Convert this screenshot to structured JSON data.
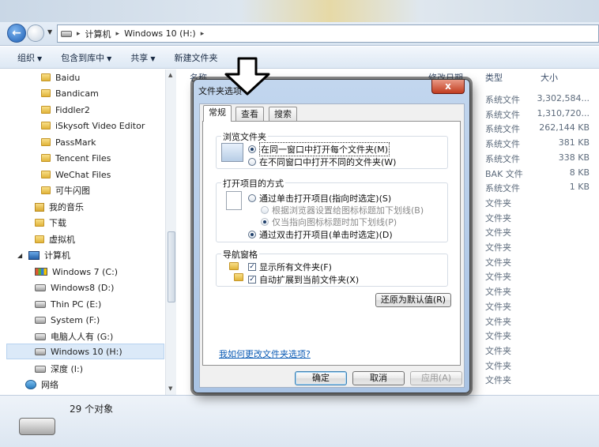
{
  "address": {
    "path": [
      "计算机",
      "Windows 10 (H:)"
    ]
  },
  "toolbar": {
    "items": [
      "组织",
      "包含到库中",
      "共享",
      "新建文件夹"
    ]
  },
  "nav": {
    "items": [
      {
        "label": "Baidu",
        "kind": "folder"
      },
      {
        "label": "Bandicam",
        "kind": "folder"
      },
      {
        "label": "Fiddler2",
        "kind": "folder"
      },
      {
        "label": "iSkysoft Video Editor",
        "kind": "folder"
      },
      {
        "label": "PassMark",
        "kind": "folder"
      },
      {
        "label": "Tencent Files",
        "kind": "folder"
      },
      {
        "label": "WeChat Files",
        "kind": "folder"
      },
      {
        "label": "可牛闪图",
        "kind": "folder"
      },
      {
        "label": "我的音乐",
        "kind": "music"
      },
      {
        "label": "下载",
        "kind": "download"
      },
      {
        "label": "虚拟机",
        "kind": "folder"
      },
      {
        "label": "计算机",
        "kind": "pc"
      },
      {
        "label": "Windows 7  (C:)",
        "kind": "win"
      },
      {
        "label": "Windows8 (D:)",
        "kind": "drive"
      },
      {
        "label": "Thin PC (E:)",
        "kind": "drive"
      },
      {
        "label": "System (F:)",
        "kind": "drive"
      },
      {
        "label": "电脑人人有 (G:)",
        "kind": "drive"
      },
      {
        "label": "Windows 10 (H:)",
        "kind": "drive",
        "selected": true
      },
      {
        "label": "深度 (I:)",
        "kind": "drive"
      },
      {
        "label": "网络",
        "kind": "net"
      }
    ]
  },
  "filelist": {
    "header_name": "名称",
    "header_date": "修改日期",
    "header_type": "类型",
    "header_size": "大小",
    "rows": [
      {
        "type": "系统文件",
        "size": "3,302,584..."
      },
      {
        "type": "系统文件",
        "size": "1,310,720..."
      },
      {
        "type": "系统文件",
        "size": "262,144 KB"
      },
      {
        "type": "系统文件",
        "size": "381 KB"
      },
      {
        "type": "系统文件",
        "size": "338 KB"
      },
      {
        "type": "BAK 文件",
        "size": "8 KB"
      },
      {
        "type": "系统文件",
        "size": "1 KB"
      },
      {
        "type": "文件夹",
        "size": ""
      },
      {
        "type": "文件夹",
        "size": ""
      },
      {
        "type": "文件夹",
        "size": ""
      },
      {
        "type": "文件夹",
        "size": ""
      },
      {
        "type": "文件夹",
        "size": ""
      },
      {
        "type": "文件夹",
        "size": ""
      },
      {
        "type": "文件夹",
        "size": ""
      },
      {
        "type": "文件夹",
        "size": ""
      },
      {
        "type": "文件夹",
        "size": ""
      },
      {
        "type": "文件夹",
        "size": ""
      },
      {
        "type": "文件夹",
        "size": ""
      },
      {
        "type": "文件夹",
        "size": ""
      },
      {
        "type": "文件夹",
        "size": ""
      }
    ]
  },
  "status": {
    "count": "29 个对象"
  },
  "dialog": {
    "title": "文件夹选项",
    "close": "x",
    "tabs": [
      "常规",
      "查看",
      "搜索"
    ],
    "browse": {
      "title": "浏览文件夹",
      "opt1": "在同一窗口中打开每个文件夹(M)",
      "opt2": "在不同窗口中打开不同的文件夹(W)"
    },
    "click": {
      "title": "打开项目的方式",
      "opt1": "通过单击打开项目(指向时选定)(S)",
      "sub1": "根据浏览器设置给图标标题加下划线(B)",
      "sub2": "仅当指向图标标题时加下划线(P)",
      "opt2": "通过双击打开项目(单击时选定)(D)"
    },
    "navpane": {
      "title": "导航窗格",
      "chk1": "显示所有文件夹(F)",
      "chk2": "自动扩展到当前文件夹(X)"
    },
    "restore": "还原为默认值(R)",
    "help_link": "我如何更改文件夹选项?",
    "ok": "确定",
    "cancel": "取消",
    "apply": "应用(A)"
  }
}
